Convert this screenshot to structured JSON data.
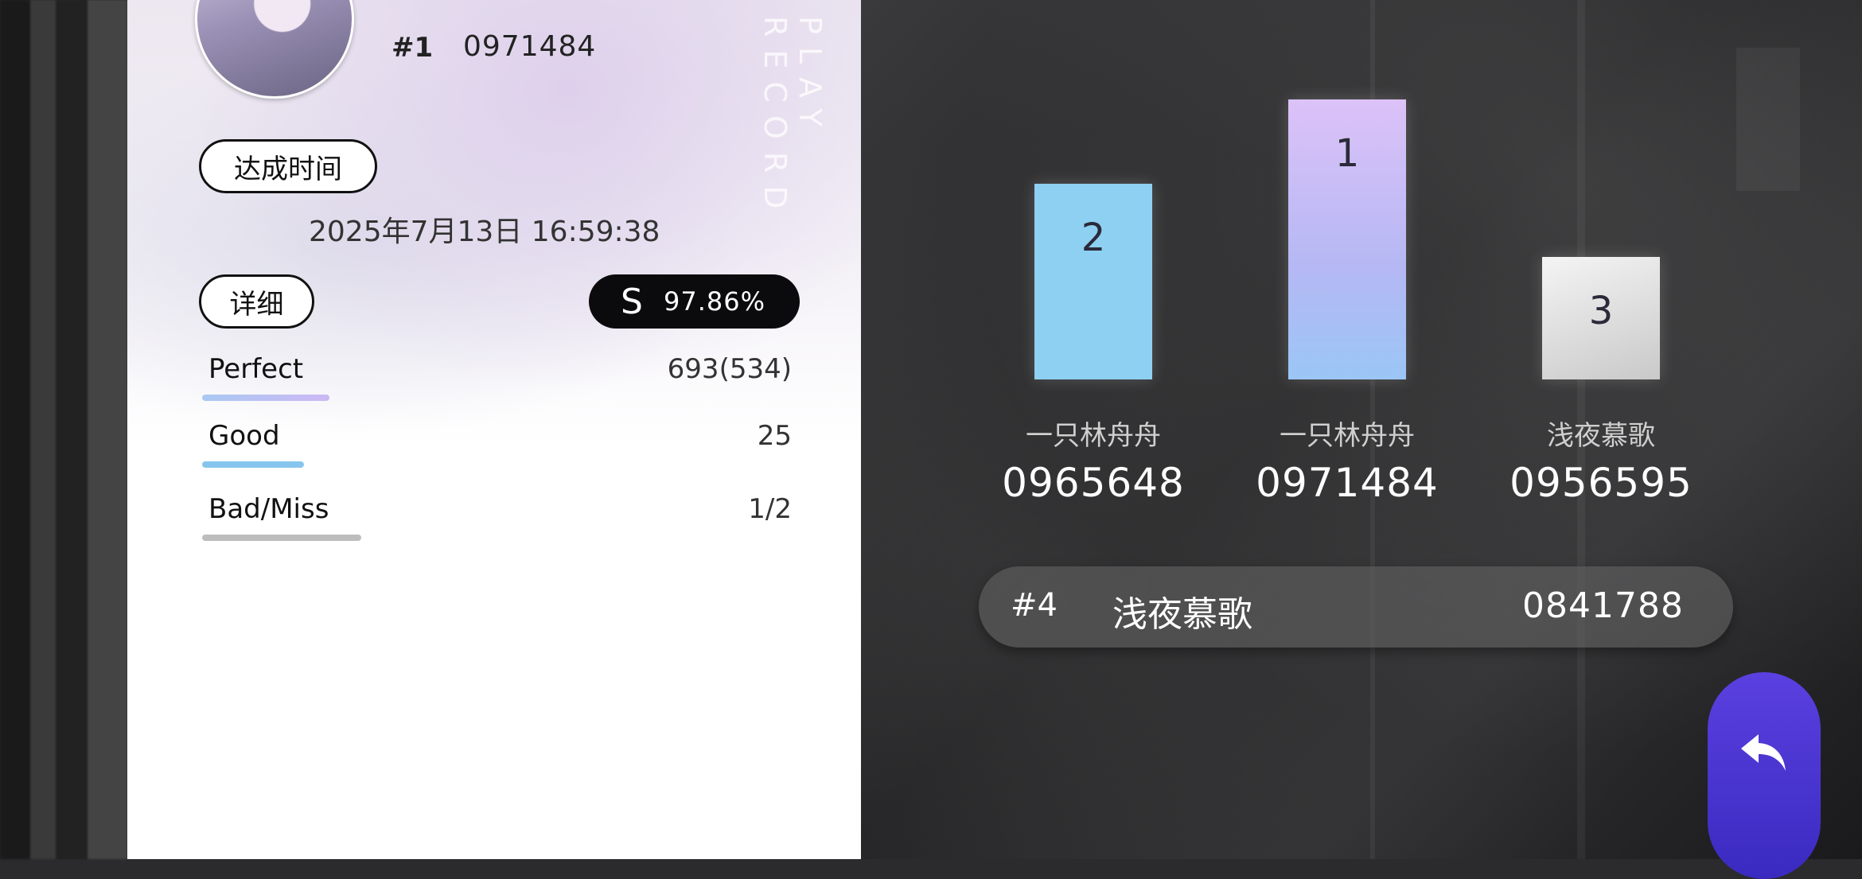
{
  "header": {
    "rank": "#1",
    "score": "0971484"
  },
  "decor_text": "PLAY RECORD",
  "achieved": {
    "label": "达成时间",
    "datetime": "2025年7月13日 16:59:38"
  },
  "detail": {
    "label": "详细",
    "grade": "S",
    "accuracy": "97.86%"
  },
  "judgements": [
    {
      "label": "Perfect",
      "value": "693(534)",
      "color": "#c9b8f2"
    },
    {
      "label": "Good",
      "value": "25",
      "color": "#86c6ee"
    },
    {
      "label": "Bad/Miss",
      "value": "1/2",
      "color": "#bdbdbd"
    }
  ],
  "podium": [
    {
      "place": "2",
      "name": "一只林舟舟",
      "score": "0965648"
    },
    {
      "place": "1",
      "name": "一只林舟舟",
      "score": "0971484"
    },
    {
      "place": "3",
      "name": "浅夜慕歌",
      "score": "0956595"
    }
  ],
  "row4": {
    "rank": "#4",
    "name": "浅夜慕歌",
    "score": "0841788"
  },
  "icons": {
    "back": "back-arrow-icon",
    "grade": "grade-badge-icon"
  },
  "colors": {
    "accent_back": "#4b36d6",
    "bar_second": "#8ed0f2",
    "bar_first_top": "#dcc2f8",
    "bar_third": "#e6e6e6"
  }
}
